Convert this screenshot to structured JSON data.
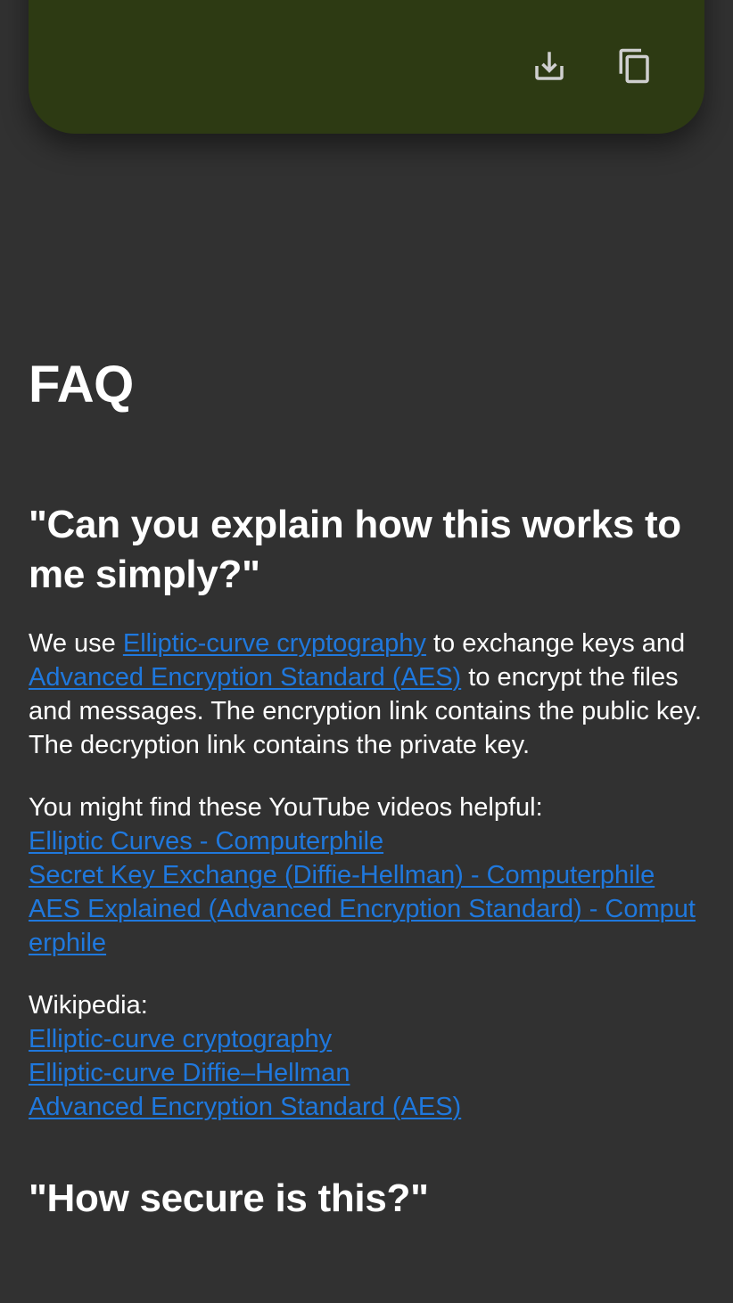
{
  "card": {
    "download_icon": "download-icon",
    "copy_icon": "copy-icon",
    "color": "#2d3a13"
  },
  "faq": {
    "title": "FAQ",
    "q1": {
      "question": "\"Can you explain how this works to me simply?\"",
      "intro_before": "We use ",
      "ecc_link": "Elliptic-curve cryptography",
      "intro_mid1": " to exchange keys and ",
      "aes_link": "Advanced Encryption Standard (AES)",
      "intro_after": " to encrypt the files and messages. The encryption link contains the public key. The decryption link contains the private key.",
      "videos_label": "You might find these YouTube videos helpful:",
      "videos": [
        "Elliptic Curves - Computerphile",
        "Secret Key Exchange (Diffie-Hellman) - Computerphile",
        "AES Explained (Advanced Encryption Standard) - Computerphile"
      ],
      "wiki_label": "Wikipedia:",
      "wiki": [
        "Elliptic-curve cryptography",
        "Elliptic-curve Diffie–Hellman",
        "Advanced Encryption Standard (AES)"
      ]
    },
    "q2": {
      "question": "\"How secure is this?\""
    }
  },
  "colors": {
    "background": "#313131",
    "link": "#1f78dd",
    "text": "#ffffff"
  }
}
